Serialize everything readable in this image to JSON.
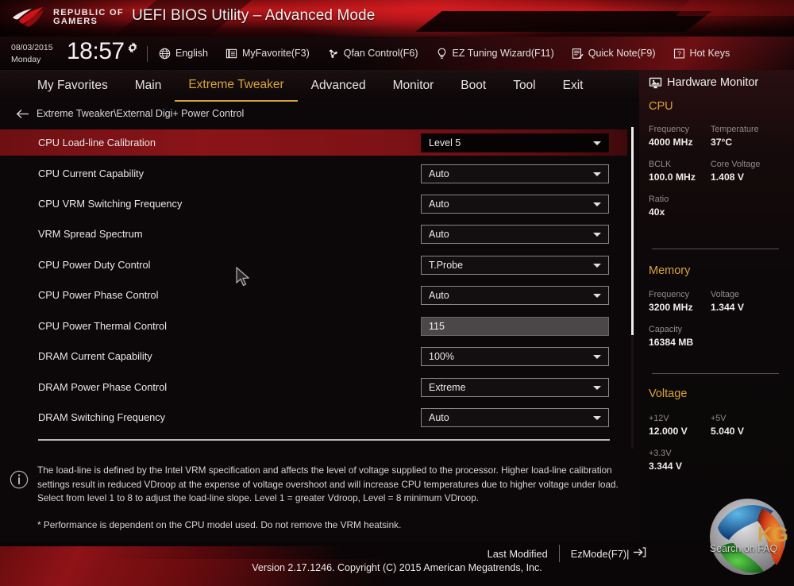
{
  "header": {
    "brand_line1": "REPUBLIC OF",
    "brand_line2": "GAMERS",
    "title": "UEFI BIOS Utility – Advanced Mode",
    "logo_icon": "rog-eye-logo"
  },
  "toolbar": {
    "date": "08/03/2015",
    "weekday": "Monday",
    "time": "18:57",
    "gear_icon": "gear-icon",
    "items": [
      {
        "label": "English",
        "icon": "globe-icon"
      },
      {
        "label": "MyFavorite(F3)",
        "icon": "bookmark-icon"
      },
      {
        "label": "Qfan Control(F6)",
        "icon": "fan-icon"
      },
      {
        "label": "EZ Tuning Wizard(F11)",
        "icon": "lightbulb-icon"
      },
      {
        "label": "Quick Note(F9)",
        "icon": "note-pencil-icon"
      },
      {
        "label": "Hot Keys",
        "icon": "question-box-icon"
      }
    ]
  },
  "tabs": [
    {
      "label": "My Favorites",
      "active": false
    },
    {
      "label": "Main",
      "active": false
    },
    {
      "label": "Extreme Tweaker",
      "active": true
    },
    {
      "label": "Advanced",
      "active": false
    },
    {
      "label": "Monitor",
      "active": false
    },
    {
      "label": "Boot",
      "active": false
    },
    {
      "label": "Tool",
      "active": false
    },
    {
      "label": "Exit",
      "active": false
    }
  ],
  "breadcrumb": {
    "back_icon": "back-arrow-icon",
    "path": "Extreme Tweaker\\External Digi+ Power Control"
  },
  "settings": [
    {
      "label": "CPU Load-line Calibration",
      "value": "Level 5",
      "type": "dropdown",
      "selected": true
    },
    {
      "label": "CPU Current Capability",
      "value": "Auto",
      "type": "dropdown",
      "selected": false
    },
    {
      "label": "CPU VRM Switching Frequency",
      "value": "Auto",
      "type": "dropdown",
      "selected": false
    },
    {
      "label": "VRM Spread Spectrum",
      "value": "Auto",
      "type": "dropdown",
      "selected": false
    },
    {
      "label": "CPU Power Duty Control",
      "value": "T.Probe",
      "type": "dropdown",
      "selected": false
    },
    {
      "label": "CPU Power Phase Control",
      "value": "Auto",
      "type": "dropdown",
      "selected": false
    },
    {
      "label": "CPU Power Thermal Control",
      "value": "115",
      "type": "text",
      "selected": false
    },
    {
      "label": "DRAM Current Capability",
      "value": "100%",
      "type": "dropdown",
      "selected": false
    },
    {
      "label": "DRAM Power Phase Control",
      "value": "Extreme",
      "type": "dropdown",
      "selected": false
    },
    {
      "label": "DRAM Switching Frequency",
      "value": "Auto",
      "type": "dropdown",
      "selected": false
    }
  ],
  "help": {
    "icon": "info-icon",
    "paragraph": "The load-line is defined by the Intel VRM specification and affects the level of voltage supplied to the processor. Higher load-line calibration settings result in reduced VDroop at the expense of voltage overshoot and will increase CPU temperatures due to higher voltage under load. Select from level 1 to 8 to adjust the load-line slope. Level 1 = greater Vdroop, Level = 8 minimum VDroop.",
    "note": "* Performance is dependent on the CPU model used. Do not remove the VRM heatsink."
  },
  "hardware_monitor": {
    "title": "Hardware Monitor",
    "icon": "monitor-icon",
    "sections": [
      {
        "name": "CPU",
        "rows": [
          [
            {
              "key": "Frequency",
              "value": "4000 MHz"
            },
            {
              "key": "Temperature",
              "value": "37°C"
            }
          ],
          [
            {
              "key": "BCLK",
              "value": "100.0 MHz"
            },
            {
              "key": "Core Voltage",
              "value": "1.408 V"
            }
          ],
          [
            {
              "key": "Ratio",
              "value": "40x"
            }
          ]
        ]
      },
      {
        "name": "Memory",
        "rows": [
          [
            {
              "key": "Frequency",
              "value": "3200 MHz"
            },
            {
              "key": "Voltage",
              "value": "1.344 V"
            }
          ],
          [
            {
              "key": "Capacity",
              "value": "16384 MB"
            }
          ]
        ]
      },
      {
        "name": "Voltage",
        "rows": [
          [
            {
              "key": "+12V",
              "value": "12.000 V"
            },
            {
              "key": "+5V",
              "value": "5.040 V"
            }
          ],
          [
            {
              "key": "+3.3V",
              "value": "3.344 V"
            }
          ]
        ]
      }
    ]
  },
  "footer": {
    "last_modified": "Last Modified",
    "ezmode": "EzMode(F7)|",
    "ezmode_icon": "exit-arrow-icon",
    "version": "Version 2.17.1246. Copyright (C) 2015 American Megatrends, Inc.",
    "watermark_text": "Search on FAQ",
    "watermark_icon": "kg-sphere-logo"
  },
  "colors": {
    "accent_gold": "#d9a43a",
    "brand_red": "#b8161a",
    "selected_row": "#8a1418",
    "panel_bg": "#0c0809"
  }
}
